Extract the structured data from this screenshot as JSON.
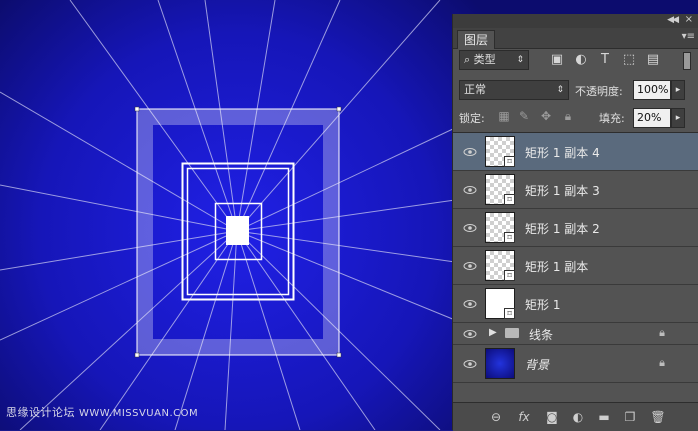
{
  "panel": {
    "tab_label": "图层",
    "filter_type": "类型",
    "blend_mode": "正常",
    "opacity_label": "不透明度:",
    "opacity_value": "100%",
    "lock_label": "锁定:",
    "fill_label": "填充:",
    "fill_value": "20%"
  },
  "layers": [
    {
      "name": "矩形 1 副本 4",
      "selected": true
    },
    {
      "name": "矩形 1 副本 3"
    },
    {
      "name": "矩形 1 副本 2"
    },
    {
      "name": "矩形 1 副本"
    },
    {
      "name": "矩形 1"
    },
    {
      "name": "线条",
      "type": "group",
      "locked": true
    },
    {
      "name": "背景",
      "locked": true
    }
  ],
  "watermark": {
    "text": "思缘设计论坛",
    "site": "WWW.MISSVUAN.COM"
  },
  "colors": {
    "canvas_blue": "#1a1ad6",
    "panel_bg": "#535353",
    "selected_row": "#5a6a7d"
  },
  "icons": {
    "filter": [
      "image-filter-icon",
      "adjustment-filter-icon",
      "type-filter-icon",
      "shape-filter-icon",
      "smart-object-filter-icon"
    ],
    "lock": [
      "lock-transparent-icon",
      "lock-paint-icon",
      "lock-move-icon",
      "lock-all-icon"
    ],
    "bottom": [
      "link-icon",
      "fx-icon",
      "mask-icon",
      "adjustment-icon",
      "new-group-icon",
      "new-layer-icon",
      "trash-icon"
    ]
  }
}
